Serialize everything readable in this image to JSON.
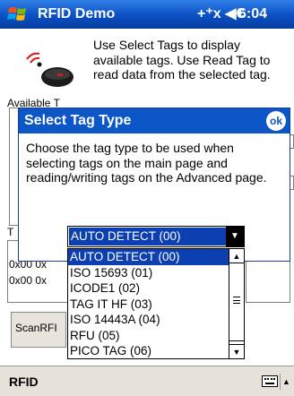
{
  "window": {
    "app_title": "RFID Demo",
    "clock": "6:04",
    "status_icons": "+⁺x ◀€"
  },
  "main": {
    "intro_text": "Use Select Tags to display available tags. Use Read Tag to read data from the selected tag.",
    "background_fragments": [
      "Available T",
      "0x00 0x",
      "0x00 0x",
      "T",
      "ScanRFI"
    ]
  },
  "dialog": {
    "title": "Select Tag Type",
    "ok_label": "ok",
    "body": "Choose the tag type to be used when selecting tags on the main page and reading/writing tags on the Advanced page."
  },
  "combo": {
    "selected_value": "AUTO DETECT (00)",
    "options": [
      "AUTO DETECT (00)",
      "ISO 15693 (01)",
      "ICODE1 (02)",
      "TAG IT HF (03)",
      "ISO 14443A (04)",
      "RFU (05)",
      "PICO TAG (06)"
    ],
    "highlighted_index": 0
  },
  "menubar": {
    "left_menu": "RFID"
  },
  "colors": {
    "title_bar": "#0c56c8",
    "selection": "#0c3fb0"
  }
}
